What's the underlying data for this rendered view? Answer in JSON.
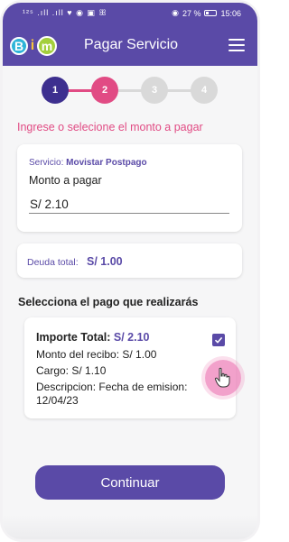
{
  "status": {
    "left_icons": "¹²⁵ .ıll .ıll ♥ ◉ ▣ ꕥ",
    "battery_text": "27 %",
    "time": "15:06"
  },
  "header": {
    "logo_b": "B",
    "logo_i": "i",
    "logo_m": "m",
    "title": "Pagar Servicio",
    "menu_icon": "hamburger-menu-icon"
  },
  "stepper": {
    "steps": [
      "1",
      "2",
      "3",
      "4"
    ],
    "current": 2,
    "colors": {
      "done": "#3d2f8f",
      "active": "#e14b84",
      "pending": "#d9d9d9"
    }
  },
  "prompt": "Ingrese o selecione el monto a pagar",
  "service": {
    "label": "Servicio:",
    "name": "Movistar Postpago",
    "amount_label": "Monto a pagar",
    "amount_value": "S/ 2.10"
  },
  "debt": {
    "label": "Deuda total:",
    "value": "S/ 1.00"
  },
  "payment": {
    "section_title": "Selecciona el pago que realizarás",
    "total_label": "Importe Total:",
    "total_value": "S/ 2.10",
    "receipt": "Monto del recibo: S/ 1.00",
    "charge": "Cargo: S/ 1.10",
    "description_line1": "Descripcion: Fecha de emision:",
    "description_line2": "12/04/23",
    "checked": true
  },
  "continue_label": "Continuar",
  "colors": {
    "primary": "#5a4aa7",
    "accent": "#e14b84"
  }
}
